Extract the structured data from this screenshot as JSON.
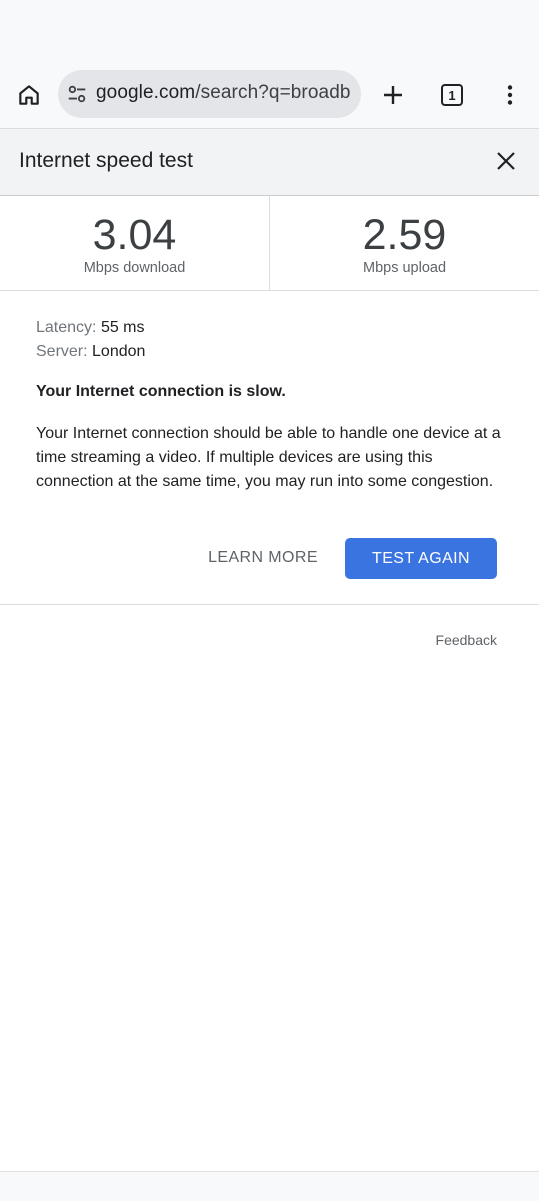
{
  "browser": {
    "url_host": "google.com",
    "url_path": "/search?q=broadb",
    "tab_count": "1",
    "icons": {
      "home": "home-icon",
      "site_settings": "tune-icon",
      "new_tab": "plus-icon",
      "tabs": "tab-switcher-icon",
      "menu": "more-vert-icon"
    }
  },
  "speed_test": {
    "title": "Internet speed test",
    "download": {
      "value": "3.04",
      "unit": "Mbps download"
    },
    "upload": {
      "value": "2.59",
      "unit": "Mbps upload"
    },
    "latency_label": "Latency:",
    "latency_value": "55 ms",
    "server_label": "Server:",
    "server_value": "London",
    "verdict": "Your Internet connection is slow.",
    "description": "Your Internet connection should be able to handle one device at a time streaming a video. If multiple devices are using this connection at the same time, you may run into some congestion.",
    "learn_more_label": "LEARN MORE",
    "test_again_label": "TEST AGAIN",
    "feedback_label": "Feedback"
  },
  "colors": {
    "accent": "#3a74e1",
    "header_bg": "#f1f3f4",
    "toolbar_bg": "#f8f9fa",
    "url_bar_bg": "#e3e5e8"
  }
}
